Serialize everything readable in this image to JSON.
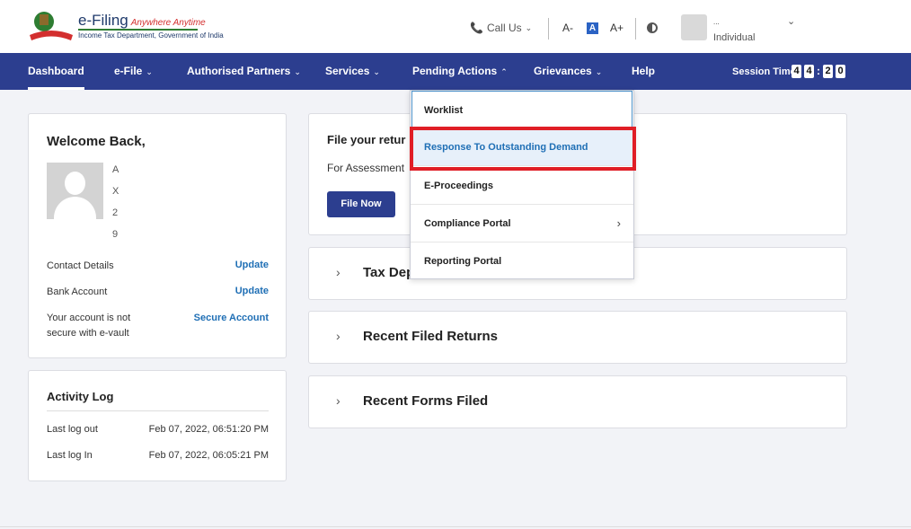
{
  "header": {
    "logo_title": "e-Filing",
    "logo_tagline": "Anywhere Anytime",
    "logo_subtitle": "Income Tax Department, Government of India",
    "call_us": "Call Us",
    "font_decrease": "A-",
    "font_normal": "A",
    "font_increase": "A+",
    "user_name": "...",
    "user_role": "Individual"
  },
  "nav": {
    "items": [
      "Dashboard",
      "e-File",
      "Authorised Partners",
      "Services",
      "Pending Actions",
      "Grievances",
      "Help"
    ],
    "session_label": "Session Time",
    "session_digits": [
      "4",
      "4",
      "2",
      "0"
    ]
  },
  "welcome": {
    "title": "Welcome Back,",
    "redacted_lines": [
      "A",
      "X",
      "2",
      "9"
    ],
    "contact_label": "Contact Details",
    "contact_link": "Update",
    "bank_label": "Bank Account",
    "bank_link": "Update",
    "secure_label_1": "Your account is not",
    "secure_label_2": "secure with e-vault",
    "secure_link": "Secure Account"
  },
  "activity": {
    "title": "Activity Log",
    "rows": [
      {
        "label": "Last log out",
        "value": "Feb 07, 2022, 06:51:20 PM"
      },
      {
        "label": "Last log In",
        "value": "Feb 07, 2022, 06:05:21 PM"
      }
    ]
  },
  "file_card": {
    "title": "File your retur",
    "subtitle": "For Assessment",
    "button": "File Now"
  },
  "accordions": [
    "Tax Dep",
    "Recent Filed Returns",
    "Recent Forms Filed"
  ],
  "dropdown": {
    "items": [
      "Worklist",
      "Response To Outstanding Demand",
      "E-Proceedings",
      "Compliance Portal",
      "Reporting Portal"
    ]
  },
  "colors": {
    "nav_bg": "#2c3e8f",
    "link": "#1f6fb5",
    "highlight_border": "#e01e26"
  }
}
